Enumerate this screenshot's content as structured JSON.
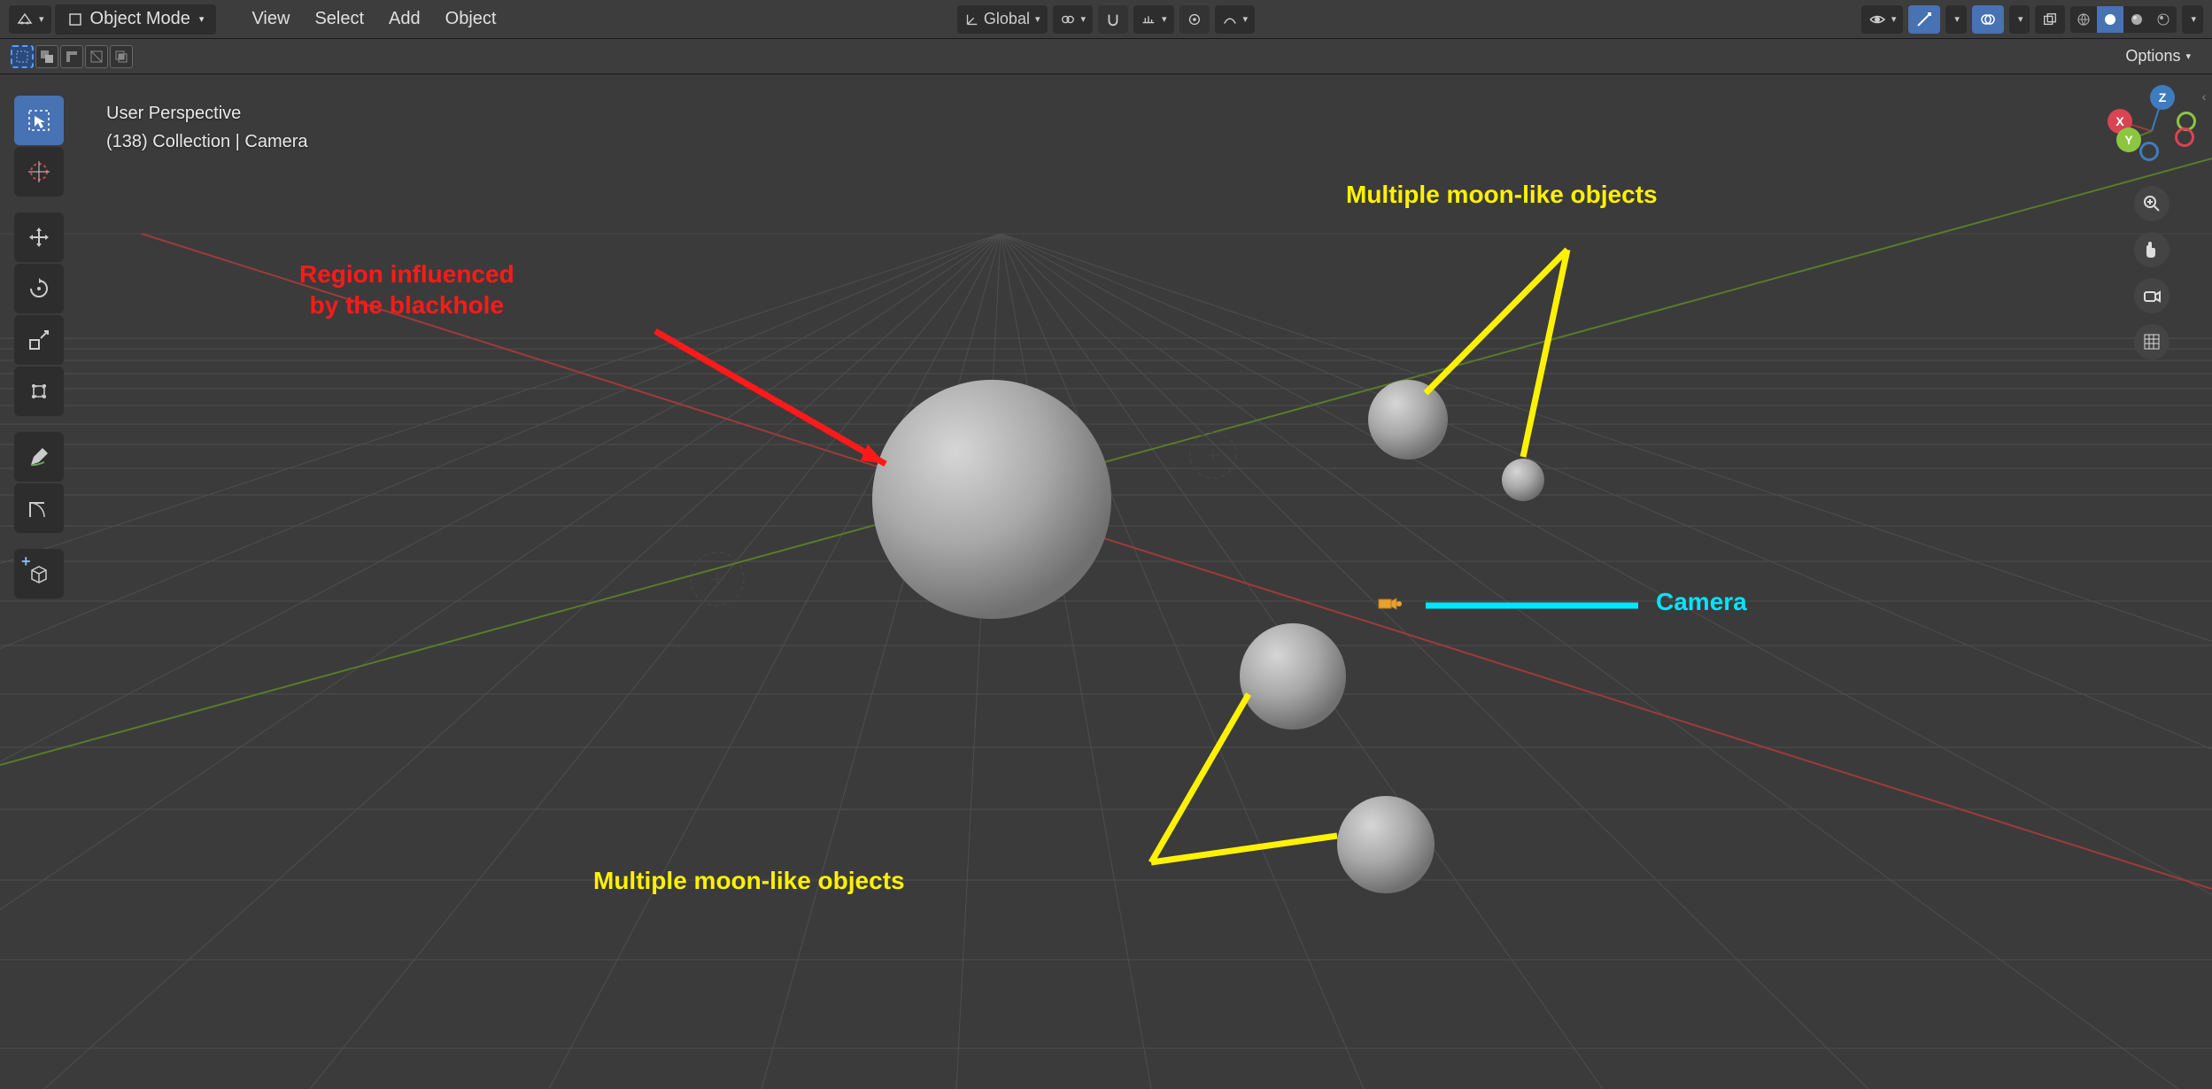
{
  "header": {
    "mode_label": "Object Mode",
    "menus": [
      "View",
      "Select",
      "Add",
      "Object"
    ],
    "orientation": "Global",
    "options_label": "Options"
  },
  "viewport": {
    "perspective_label": "User Perspective",
    "context_line": "(138) Collection | Camera"
  },
  "gizmo": {
    "x": "X",
    "y": "Y",
    "z": "Z"
  },
  "annotations": {
    "blackhole": "Region influenced\nby the blackhole",
    "blackhole_l1": "Region influenced",
    "blackhole_l2": "by the blackhole",
    "moons_top": "Multiple moon-like objects",
    "moons_bottom": "Multiple moon-like objects",
    "camera": "Camera"
  },
  "tools": {
    "select_box": "select-box",
    "cursor": "cursor-3d",
    "move": "move",
    "rotate": "rotate",
    "scale": "scale",
    "transform": "transform",
    "annotate": "annotate",
    "measure": "measure",
    "add_cube": "add-cube"
  }
}
